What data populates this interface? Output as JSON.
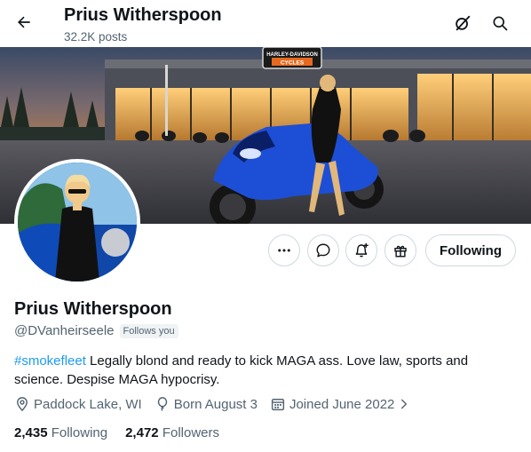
{
  "header": {
    "title": "Prius Witherspoon",
    "posts_count": "32.2K posts"
  },
  "profile": {
    "name": "Prius Witherspoon",
    "handle": "@DVanheirseele",
    "follows_you": "Follows you",
    "bio_hashtag": "#smokefleet",
    "bio_text": " Legally blond and ready to kick MAGA ass. Love law, sports and science. Despise MAGA hypocrisy.",
    "location": "Paddock Lake, WI",
    "birthday": "Born August 3",
    "joined": "Joined June 2022",
    "following_count": "2,435",
    "following_label": "Following",
    "followers_count": "2,472",
    "followers_label": "Followers"
  },
  "banner_text": {
    "sign_line1": "HARLEY-DAVIDSON",
    "sign_line2": "CYCLES"
  },
  "buttons": {
    "following": "Following"
  },
  "icons": {
    "back": "arrow-left-icon",
    "grok": "grok-icon",
    "search": "search-icon",
    "more": "more-icon",
    "message": "message-icon",
    "notify": "bell-plus-icon",
    "subscribe": "gift-icon",
    "location": "location-pin-icon",
    "birthday": "balloon-icon",
    "calendar": "calendar-icon",
    "chevron": "chevron-right-icon"
  },
  "colors": {
    "accent": "#1d9bf0",
    "text_primary": "#0f1419",
    "text_secondary": "#536471",
    "motorcycle_blue": "#1d4fd6"
  }
}
